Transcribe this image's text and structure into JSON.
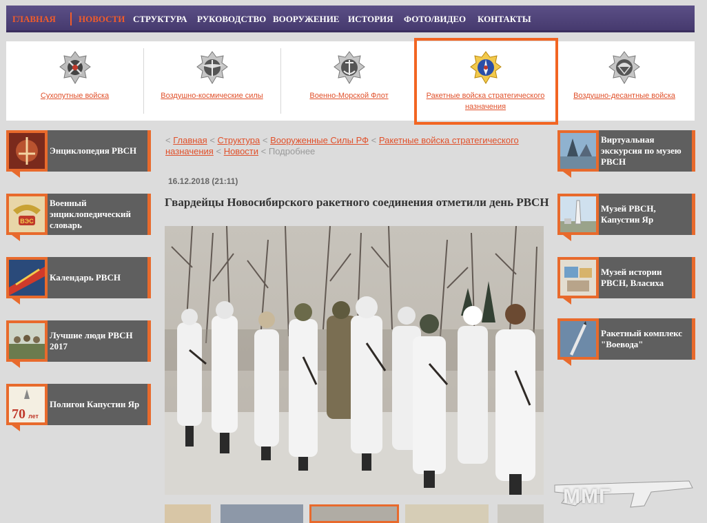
{
  "nav": {
    "items": [
      "ГЛАВНАЯ",
      "НОВОСТИ",
      "СТРУКТУРА",
      "РУКОВОДСТВО",
      "ВООРУЖЕНИЕ",
      "ИСТОРИЯ",
      "ФОТО/ВИДЕО",
      "КОНТАКТЫ"
    ],
    "active": "НОВОСТИ"
  },
  "branches": [
    {
      "label": "Сухопутные войска",
      "icon": "ground-forces-emblem-icon"
    },
    {
      "label": "Воздушно-космические силы",
      "icon": "aerospace-forces-emblem-icon"
    },
    {
      "label": "Военно-Морской Флот",
      "icon": "navy-emblem-icon"
    },
    {
      "label": "Ракетные войска стратегического назначения",
      "icon": "strategic-missile-forces-emblem-icon",
      "highlighted": true
    },
    {
      "label": "Воздушно-десантные войска",
      "icon": "airborne-forces-emblem-icon"
    }
  ],
  "left_links": [
    {
      "label": "Энциклопедия РВСН"
    },
    {
      "label": "Военный энциклопедический словарь"
    },
    {
      "label": "Календарь РВСН"
    },
    {
      "label": "Лучшие люди РВСН 2017"
    },
    {
      "label": "Полигон Капустин Яр"
    }
  ],
  "right_links": [
    {
      "label": "Виртуальная экскурсия по музею РВСН"
    },
    {
      "label": "Музей РВСН, Капустин Яр"
    },
    {
      "label": "Музей истории РВСН, Власиха"
    },
    {
      "label": "Ракетный комплекс \"Воевода\""
    }
  ],
  "breadcrumb": {
    "items": [
      "Главная",
      "Структура",
      "Вооруженные Силы РФ",
      "Ракетные войска стратегического назначения",
      "Новости"
    ],
    "current": "Подробнее",
    "separator": "<"
  },
  "article": {
    "date": "16.12.2018 (21:11)",
    "title": "Гвардейцы Новосибирского ракетного соединения отметили день РВСН"
  },
  "watermark": {
    "text": "ММГ"
  },
  "colors": {
    "accent": "#e86a2c",
    "nav_bg": "#4f4479",
    "box_bg": "#5f5f5f",
    "link": "#e0502a"
  }
}
